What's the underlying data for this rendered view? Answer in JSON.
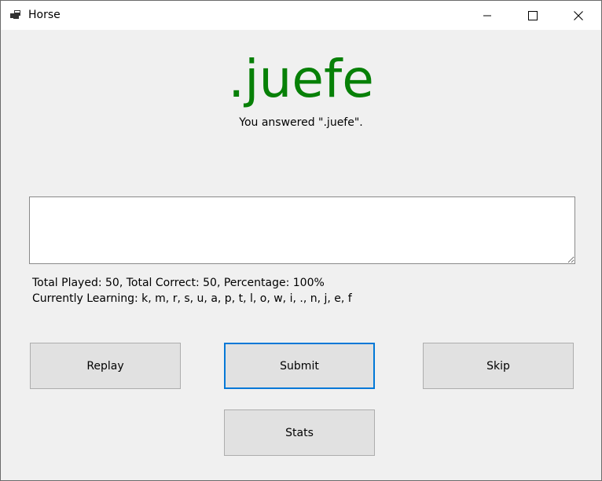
{
  "window": {
    "title": "Horse",
    "icon": "app-window-icon",
    "controls": {
      "minimize_icon": "minimize-icon",
      "maximize_icon": "maximize-icon",
      "close_icon": "close-icon"
    }
  },
  "main": {
    "word": ".juefe",
    "word_color": "#078007",
    "answer_text": "You answered \".juefe\".",
    "input_value": ""
  },
  "stats": {
    "summary": "Total Played: 50, Total Correct: 50, Percentage: 100%",
    "learning": "Currently Learning: k, m, r, s, u, a, p, t, l, o, w, i, ., n, j, e, f"
  },
  "buttons": {
    "replay": "Replay",
    "submit": "Submit",
    "skip": "Skip",
    "stats": "Stats"
  },
  "colors": {
    "focus_border": "#0078d7",
    "button_bg": "#e1e1e1",
    "window_bg": "#f0f0f0"
  }
}
